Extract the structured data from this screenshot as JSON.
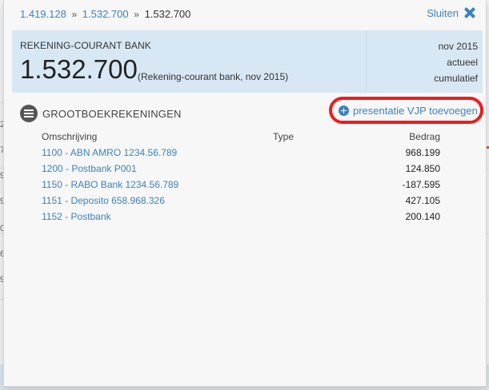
{
  "background": {
    "left_digits": [
      "2",
      "7",
      "9",
      "9",
      "0",
      "6",
      "9"
    ]
  },
  "breadcrumb": {
    "items": [
      "1.419.128",
      "1.532.700",
      "1.532.700"
    ],
    "separator": "»"
  },
  "close": {
    "label": "Sluiten",
    "icon": "close-x-icon"
  },
  "summary": {
    "account_label": "REKENING-COURANT BANK",
    "amount": "1.532.700",
    "amount_note": "(Rekening-courant bank, nov 2015)",
    "period": "nov 2015",
    "mode": "actueel",
    "aggregation": "cumulatief"
  },
  "section": {
    "title": "GROOTBOEKREKENINGEN",
    "icon": "ledger-list-icon"
  },
  "add_presentation": {
    "label": "presentatie VJP toevoegen",
    "icon": "plus-circle-icon"
  },
  "table": {
    "headers": {
      "description": "Omschrijving",
      "type": "Type",
      "amount": "Bedrag"
    },
    "rows": [
      {
        "description": "1100 - ABN AMRO 1234.56.789",
        "type": "",
        "amount": "968.199"
      },
      {
        "description": "1200 - Postbank P001",
        "type": "",
        "amount": "124.850"
      },
      {
        "description": "1150 - RABO Bank 1234.56.789",
        "type": "",
        "amount": "-187.595"
      },
      {
        "description": "1151 - Deposito 658.968.326",
        "type": "",
        "amount": "427.105"
      },
      {
        "description": "1152 - Postbank",
        "type": "",
        "amount": "200.140"
      }
    ]
  },
  "colors": {
    "link": "#3b83c0",
    "summary_bg": "#d8e7f4",
    "highlight_ring": "#ee1c1c"
  }
}
